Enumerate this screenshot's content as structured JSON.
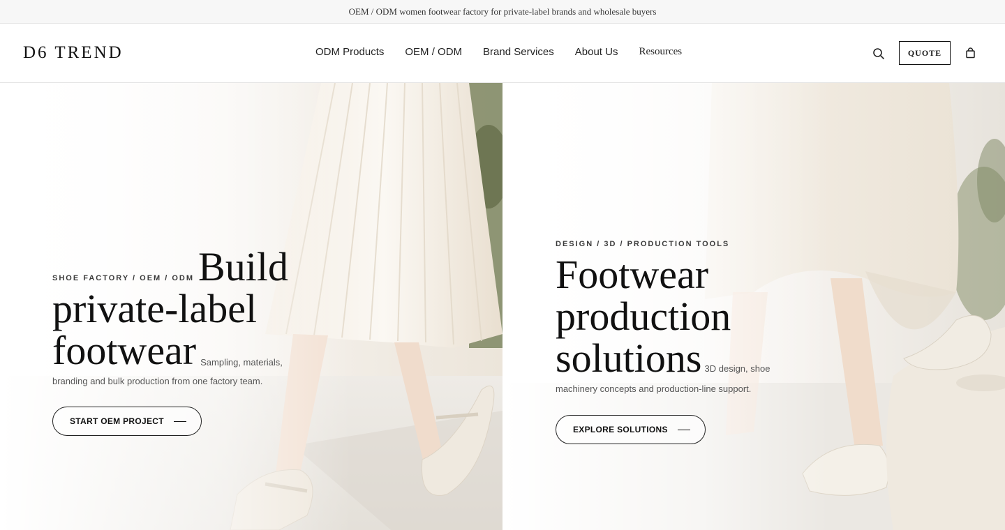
{
  "announcement": "OEM / ODM women footwear factory for private-label brands and wholesale buyers",
  "header": {
    "logo": "D6 TREND",
    "nav": [
      "ODM Products",
      "OEM / ODM",
      "Brand Services",
      "About Us",
      "Resources"
    ],
    "quote_label": "QUOTE",
    "icons": [
      "search-icon",
      "bag-icon"
    ]
  },
  "hero_left": {
    "eyebrow": "SHOE FACTORY / OEM / ODM",
    "headline_1": "Build",
    "headline_2": "private-label",
    "headline_3": "footwear",
    "desc_1": "Sampling, materials,",
    "desc_2": "branding and bulk production from one factory team.",
    "cta": "START OEM PROJECT"
  },
  "hero_right": {
    "eyebrow": "DESIGN / 3D / PRODUCTION TOOLS",
    "headline_1": "Footwear",
    "headline_2": "production",
    "headline_3": "solutions",
    "desc_1": "3D design, shoe",
    "desc_2": "machinery concepts and production-line support.",
    "cta": "EXPLORE SOLUTIONS"
  },
  "colors": {
    "text": "#111111",
    "topbar_bg": "#f7f7f7",
    "hero_cream": "#efe8dc",
    "foliage": "#6f7a52"
  }
}
